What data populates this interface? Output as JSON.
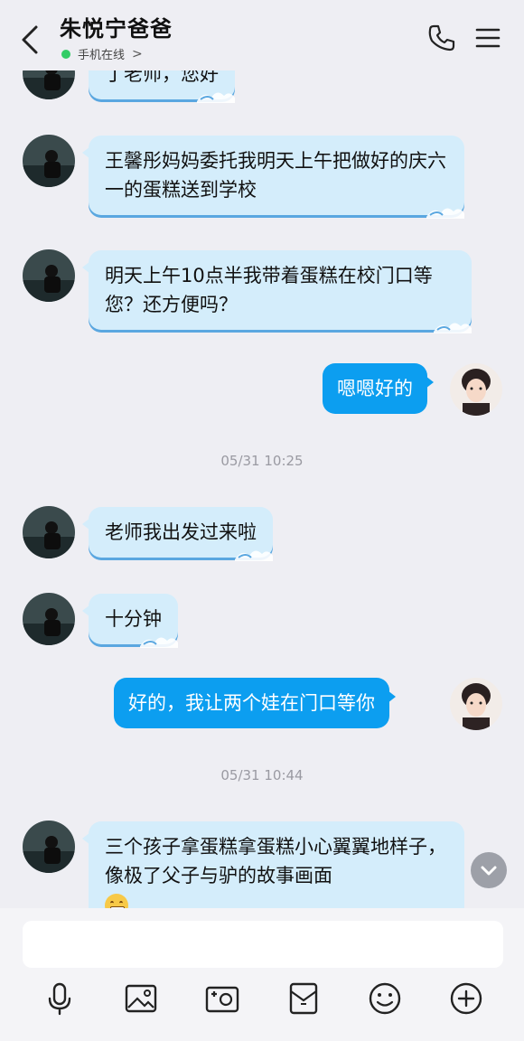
{
  "header": {
    "contact_name": "朱悦宁爸爸",
    "status": "手机在线",
    "status_chevron": ">"
  },
  "messages": [
    {
      "side": "left",
      "text": "丁老师，您好"
    },
    {
      "side": "left",
      "text": "王馨彤妈妈委托我明天上午把做好的庆六一的蛋糕送到学校"
    },
    {
      "side": "left",
      "text": "明天上午10点半我带着蛋糕在校门口等您？还方便吗？"
    },
    {
      "side": "right",
      "text": "嗯嗯好的"
    },
    {
      "side": "left",
      "text": "老师我出发过来啦"
    },
    {
      "side": "left",
      "text": "十分钟"
    },
    {
      "side": "right",
      "text": "好的，我让两个娃在门口等你"
    },
    {
      "side": "left",
      "text": "三个孩子拿蛋糕拿蛋糕小心翼翼地样子，像极了父子与驴的故事画面"
    }
  ],
  "timestamps": [
    "05/31 10:25",
    "05/31 10:44"
  ],
  "icons": {
    "back": "back-chevron-icon",
    "phone": "phone-icon",
    "menu": "menu-icon",
    "scroll_down": "chevron-down-icon",
    "toolbar": [
      "microphone-icon",
      "image-icon",
      "camera-icon",
      "red-packet-icon",
      "emoji-icon",
      "plus-icon"
    ]
  },
  "colors": {
    "background": "#eeeef3",
    "left_bubble": "#d4edfb",
    "right_bubble": "#0c9ef0",
    "online_dot": "#33cc66"
  },
  "input": {
    "value": "",
    "placeholder": ""
  }
}
